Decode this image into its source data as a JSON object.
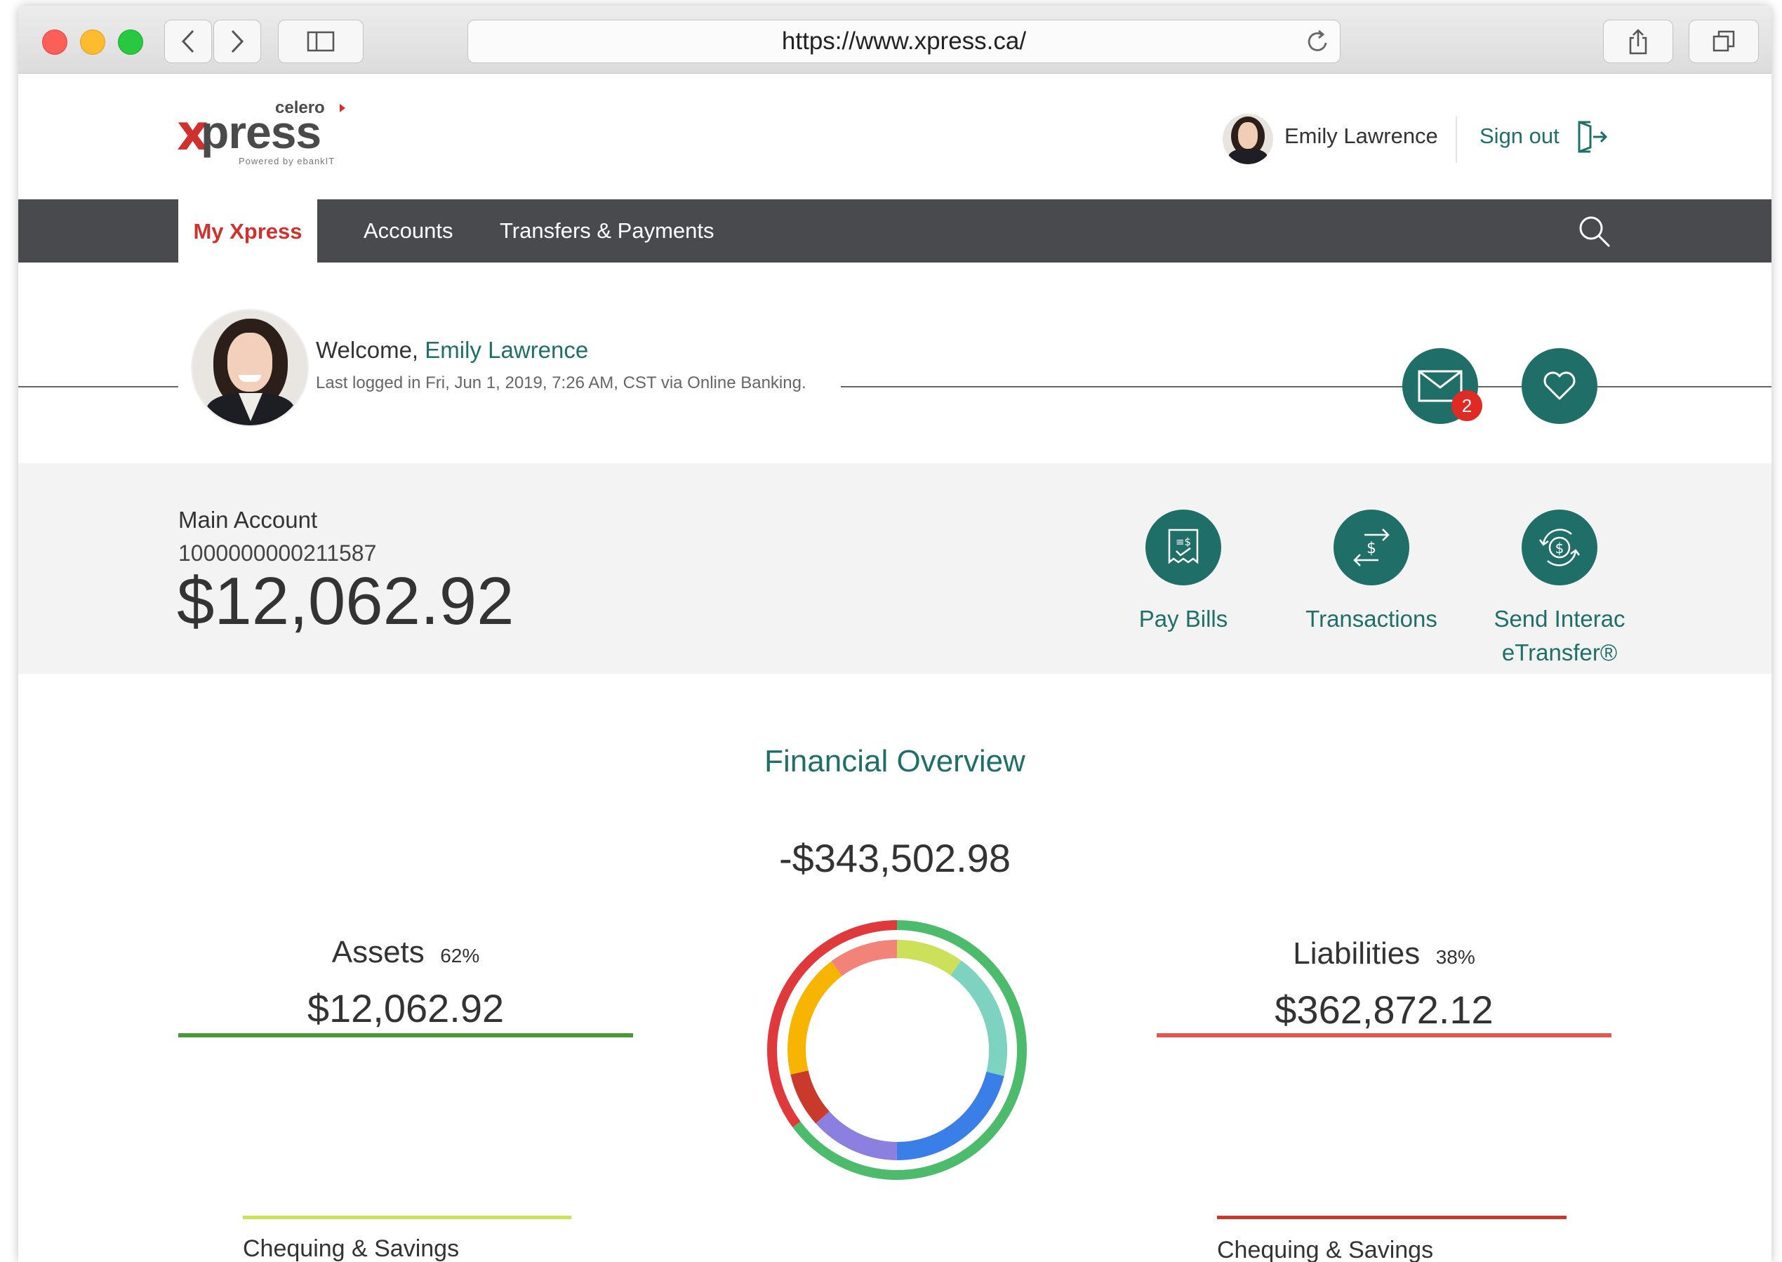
{
  "browser": {
    "url": "https://www.xpress.ca/"
  },
  "header": {
    "logo_brand_small": "celero",
    "logo_brand": "xpress",
    "logo_tagline": "Powered by ebankIT",
    "user_name": "Emily Lawrence",
    "sign_out_label": "Sign out"
  },
  "nav": {
    "items": [
      {
        "label": "My Xpress"
      },
      {
        "label": "Accounts"
      },
      {
        "label": "Transfers & Payments"
      }
    ]
  },
  "welcome": {
    "greeting": "Welcome,",
    "name": "Emily Lawrence",
    "last_login": "Last logged in Fri, Jun 1, 2019, 7:26 AM, CST via Online Banking.",
    "messages_badge": "2"
  },
  "account": {
    "title": "Main Account",
    "number": "1000000000211587",
    "balance": "$12,062.92"
  },
  "actions": [
    {
      "label": "Pay Bills"
    },
    {
      "label": "Transactions"
    },
    {
      "label": "Send Interac eTransfer®"
    }
  ],
  "overview": {
    "title": "Financial Overview",
    "net_total": "-$343,502.98",
    "assets": {
      "label": "Assets",
      "percent": "62%",
      "amount": "$12,062.92",
      "sub_category": "Chequing & Savings",
      "color": "#4a9a3a"
    },
    "liabilities": {
      "label": "Liabilities",
      "percent": "38%",
      "amount": "$362,872.12",
      "sub_category": "Chequing & Savings",
      "color": "#e05a54"
    }
  },
  "colors": {
    "accent": "#1f6f68",
    "active_tab": "#d0312d",
    "nav_bg": "#494a4e",
    "outer_ring": [
      "#4cbb6c",
      "#e0393b"
    ],
    "inner_ring": [
      "#cde05a",
      "#7dd3bf",
      "#3a7fe8",
      "#8b7fe0",
      "#c93a2a",
      "#f7b400",
      "#f28379"
    ]
  }
}
